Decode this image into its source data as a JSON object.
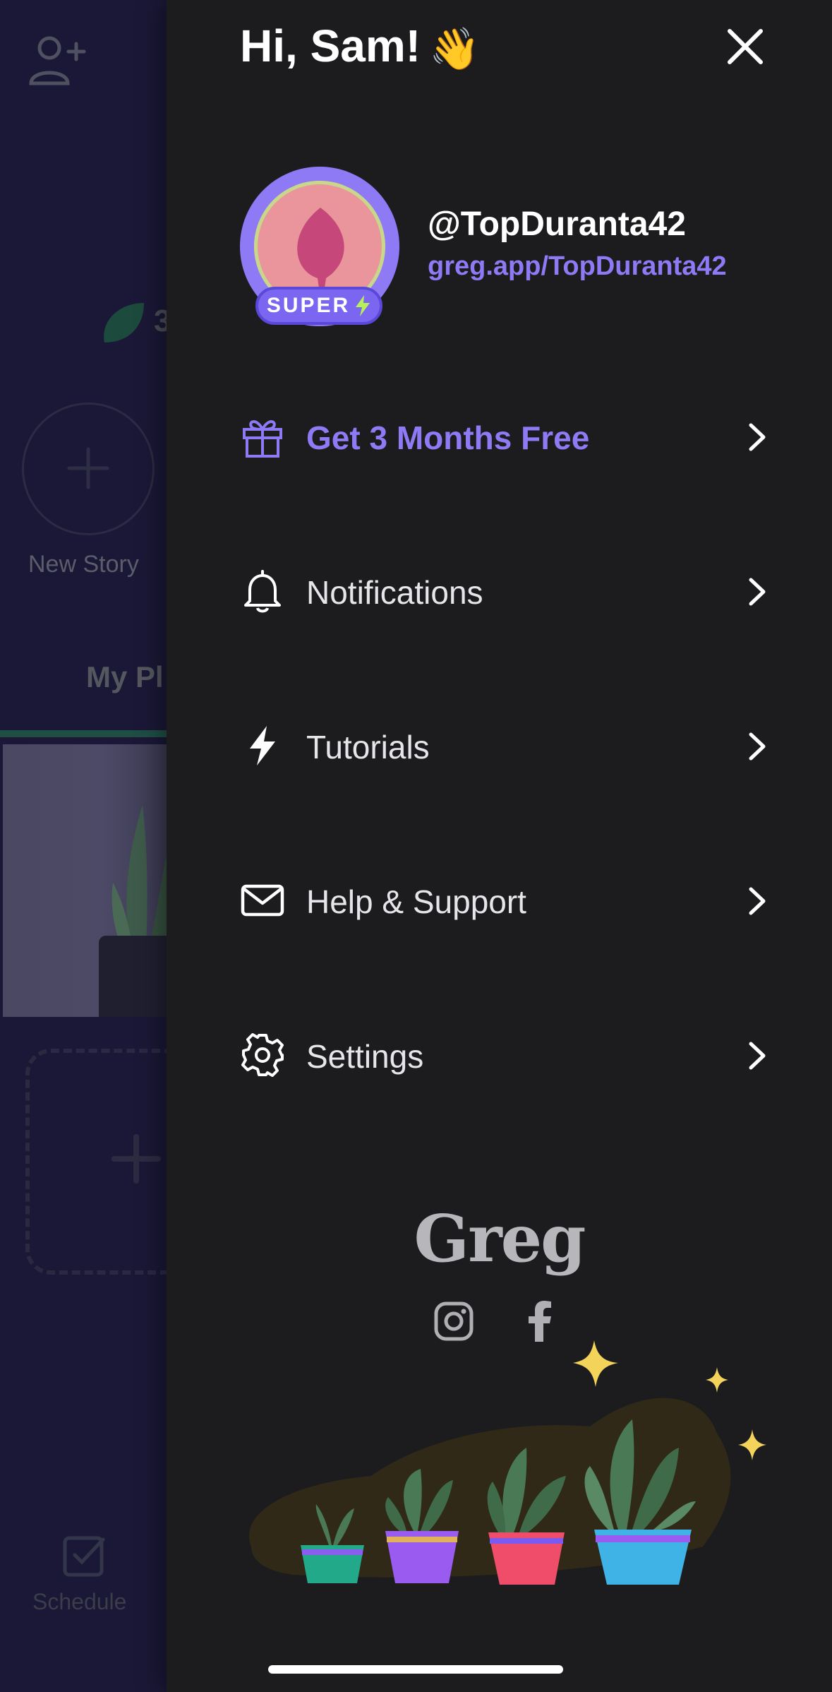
{
  "background_app": {
    "leaf_count_partial": "3",
    "new_story_label": "New Story",
    "tab_partial_label": "My Pl",
    "schedule_label": "Schedule"
  },
  "drawer": {
    "greeting": "Hi, Sam!",
    "wave_emoji": "👋",
    "profile": {
      "badge": "SUPER",
      "username": "@TopDuranta42",
      "link": "greg.app/TopDuranta42"
    },
    "menu": [
      {
        "label": "Get 3 Months Free",
        "icon": "gift-icon",
        "accent": true
      },
      {
        "label": "Notifications",
        "icon": "bell-icon",
        "accent": false
      },
      {
        "label": "Tutorials",
        "icon": "bolt-icon",
        "accent": false
      },
      {
        "label": "Help & Support",
        "icon": "envelope-icon",
        "accent": false
      },
      {
        "label": "Settings",
        "icon": "gear-icon",
        "accent": false
      }
    ],
    "brand": "Greg",
    "social": [
      "instagram-icon",
      "facebook-icon"
    ]
  },
  "colors": {
    "accent": "#8e7af5",
    "drawer_bg": "#1c1c1e",
    "background_app": "#1a1836",
    "super_badge": "#7a66f0"
  }
}
